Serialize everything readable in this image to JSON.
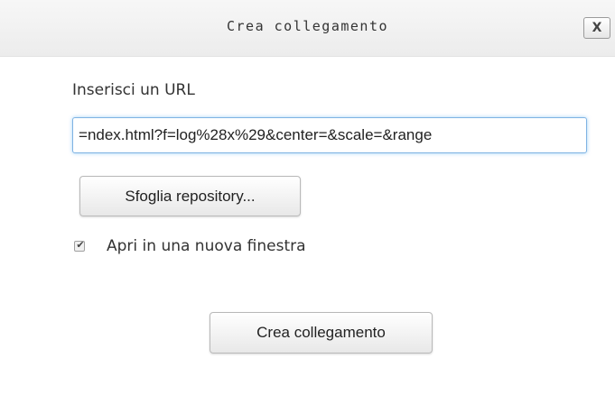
{
  "dialog": {
    "title": "Crea collegamento",
    "close_label": "X"
  },
  "url": {
    "label": "Inserisci un URL",
    "value": "ndex.html?f=log%28x%29&center=&scale=&range="
  },
  "browse_button": {
    "label": "Sfoglia repository..."
  },
  "new_window": {
    "label": "Apri in una nuova finestra",
    "checked": true,
    "check_glyph": "✔"
  },
  "submit_button": {
    "label": "Crea collegamento"
  },
  "colors": {
    "focus_border": "#7fb3e3",
    "titlebar": "#ececec"
  },
  "icons": {
    "close": "close-icon",
    "check": "checkmark-icon"
  }
}
